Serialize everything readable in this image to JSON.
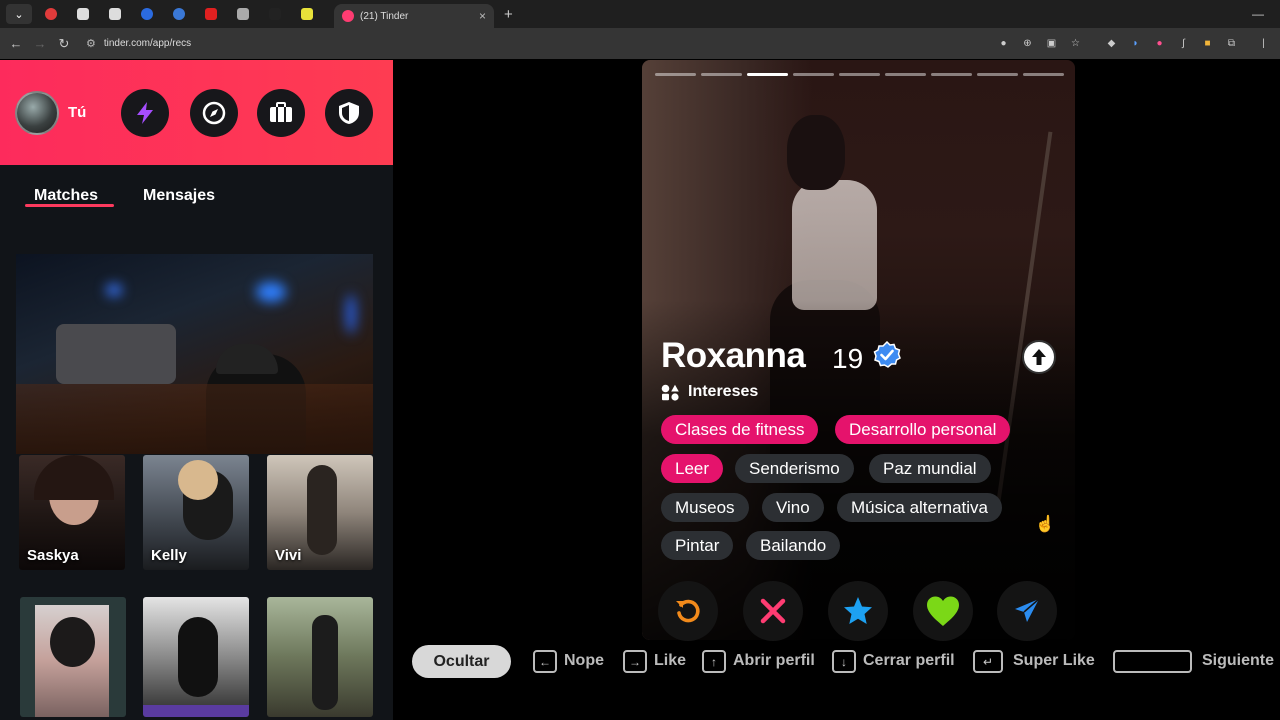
{
  "browser": {
    "active_tab_title": "(21) Tinder",
    "url": "tinder.com/app/recs"
  },
  "sidebar": {
    "user_label": "Tú",
    "tabs": [
      {
        "label": "Matches",
        "active": true
      },
      {
        "label": "Mensajes",
        "active": false
      }
    ],
    "matches": [
      {
        "name": "Saskya"
      },
      {
        "name": "Kelly"
      },
      {
        "name": "Vivi"
      }
    ]
  },
  "profile": {
    "name": "Roxanna",
    "age": "19",
    "verified": true,
    "interests_label": "Intereses",
    "photo_count": 9,
    "current_photo": 3,
    "interests": [
      {
        "label": "Clases de fitness",
        "highlight": true
      },
      {
        "label": "Desarrollo personal",
        "highlight": true
      },
      {
        "label": "Leer",
        "highlight": true
      },
      {
        "label": "Senderismo",
        "highlight": false
      },
      {
        "label": "Paz mundial",
        "highlight": false
      },
      {
        "label": "Museos",
        "highlight": false
      },
      {
        "label": "Vino",
        "highlight": false
      },
      {
        "label": "Música alternativa",
        "highlight": false
      },
      {
        "label": "Pintar",
        "highlight": false
      },
      {
        "label": "Bailando",
        "highlight": false
      }
    ]
  },
  "actions": [
    {
      "icon": "rewind-icon",
      "color": "#f28a1b"
    },
    {
      "icon": "nope-icon",
      "color": "#fe3c72"
    },
    {
      "icon": "super-like-icon",
      "color": "#1da1f2"
    },
    {
      "icon": "like-icon",
      "color": "#7bd817"
    },
    {
      "icon": "boost-icon",
      "color": "#2b8cf0"
    }
  ],
  "shortcuts": {
    "hide_label": "Ocultar",
    "nope": "Nope",
    "like": "Like",
    "open_profile": "Abrir perfil",
    "close_profile": "Cerrar perfil",
    "super_like": "Super Like",
    "next": "Siguiente"
  },
  "colors": {
    "brand": "#fd2b5c",
    "chip_highlight": "#e5136c",
    "chip_normal": "#2c2f33"
  }
}
